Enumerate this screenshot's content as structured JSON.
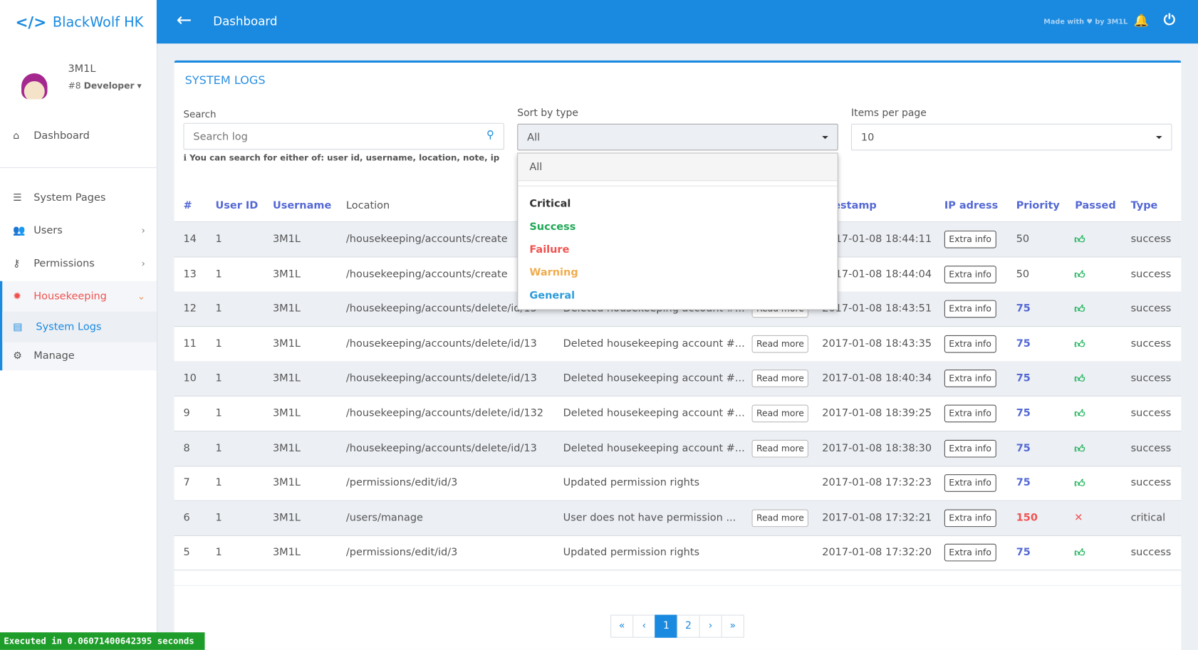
{
  "app": {
    "name": "BlackWolf HK",
    "accent": "#1a8ae0"
  },
  "user": {
    "name": "3M1L",
    "rank": "#8",
    "role": "Developer"
  },
  "topbar": {
    "title": "Dashboard",
    "credit_pre": "Made with",
    "credit_post": "by 3M1L"
  },
  "sidebar": {
    "items": [
      {
        "label": "Dashboard",
        "icon": "home-icon"
      },
      {
        "label": "System Pages",
        "icon": "list-icon"
      },
      {
        "label": "Users",
        "icon": "users-icon"
      },
      {
        "label": "Permissions",
        "icon": "key-icon"
      },
      {
        "label": "Housekeeping",
        "icon": "gear-burst-icon"
      },
      {
        "label": "System Logs",
        "icon": "file-icon"
      },
      {
        "label": "Manage",
        "icon": "cog-icon"
      }
    ]
  },
  "card": {
    "title": "SYSTEM LOGS",
    "search": {
      "label": "Search",
      "placeholder": "Search log",
      "hint": "You can search for either of: user id, username, location, note, ip"
    },
    "sort": {
      "label": "Sort by type",
      "value": "All",
      "options": [
        {
          "label": "All",
          "color": "#555555"
        },
        {
          "label": "Critical",
          "color": "#333333"
        },
        {
          "label": "Success",
          "color": "#1fa856"
        },
        {
          "label": "Failure",
          "color": "#ef5350"
        },
        {
          "label": "Warning",
          "color": "#f0ad4e"
        },
        {
          "label": "General",
          "color": "#2d9cdb"
        }
      ]
    },
    "per_page": {
      "label": "Items per page",
      "value": "10"
    }
  },
  "table": {
    "headers": {
      "id": "#",
      "user_id": "User ID",
      "username": "Username",
      "location": "Location",
      "timestamp": "Timestamp",
      "ip": "IP adress",
      "priority": "Priority",
      "passed": "Passed",
      "type": "Type"
    },
    "read_more": "Read more",
    "extra_info": "Extra info",
    "rows": [
      {
        "id": "14",
        "user_id": "1",
        "username": "3M1L",
        "location": "/housekeeping/accounts/create",
        "note": "",
        "read_more": false,
        "timestamp": "2017-01-08 18:44:11",
        "priority": "50",
        "passed": true,
        "type": "success"
      },
      {
        "id": "13",
        "user_id": "1",
        "username": "3M1L",
        "location": "/housekeeping/accounts/create",
        "note": "",
        "read_more": false,
        "timestamp": "2017-01-08 18:44:04",
        "priority": "50",
        "passed": true,
        "type": "success"
      },
      {
        "id": "12",
        "user_id": "1",
        "username": "3M1L",
        "location": "/housekeeping/accounts/delete/id/13",
        "note": "Deleted housekeeping account #...",
        "read_more": true,
        "timestamp": "2017-01-08 18:43:51",
        "priority": "75",
        "passed": true,
        "type": "success"
      },
      {
        "id": "11",
        "user_id": "1",
        "username": "3M1L",
        "location": "/housekeeping/accounts/delete/id/13",
        "note": "Deleted housekeeping account #...",
        "read_more": true,
        "timestamp": "2017-01-08 18:43:35",
        "priority": "75",
        "passed": true,
        "type": "success"
      },
      {
        "id": "10",
        "user_id": "1",
        "username": "3M1L",
        "location": "/housekeeping/accounts/delete/id/13",
        "note": "Deleted housekeeping account #...",
        "read_more": true,
        "timestamp": "2017-01-08 18:40:34",
        "priority": "75",
        "passed": true,
        "type": "success"
      },
      {
        "id": "9",
        "user_id": "1",
        "username": "3M1L",
        "location": "/housekeeping/accounts/delete/id/132",
        "note": "Deleted housekeeping account #...",
        "read_more": true,
        "timestamp": "2017-01-08 18:39:25",
        "priority": "75",
        "passed": true,
        "type": "success"
      },
      {
        "id": "8",
        "user_id": "1",
        "username": "3M1L",
        "location": "/housekeeping/accounts/delete/id/13",
        "note": "Deleted housekeeping account #...",
        "read_more": true,
        "timestamp": "2017-01-08 18:38:30",
        "priority": "75",
        "passed": true,
        "type": "success"
      },
      {
        "id": "7",
        "user_id": "1",
        "username": "3M1L",
        "location": "/permissions/edit/id/3",
        "note": "Updated permission rights",
        "read_more": false,
        "timestamp": "2017-01-08 17:32:23",
        "priority": "75",
        "passed": true,
        "type": "success"
      },
      {
        "id": "6",
        "user_id": "1",
        "username": "3M1L",
        "location": "/users/manage",
        "note": "User does not have permission ...",
        "read_more": true,
        "timestamp": "2017-01-08 17:32:21",
        "priority": "150",
        "passed": false,
        "type": "critical"
      },
      {
        "id": "5",
        "user_id": "1",
        "username": "3M1L",
        "location": "/permissions/edit/id/3",
        "note": "Updated permission rights",
        "read_more": false,
        "timestamp": "2017-01-08 17:32:20",
        "priority": "75",
        "passed": true,
        "type": "success"
      }
    ]
  },
  "pagination": {
    "first": "«",
    "prev": "‹",
    "pages": [
      "1",
      "2"
    ],
    "current": "1",
    "next": "›",
    "last": "»"
  },
  "footer": {
    "exec": "Executed in 0.06071400642395 seconds"
  }
}
